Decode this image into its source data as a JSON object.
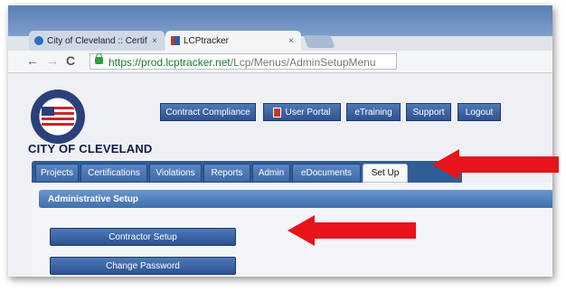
{
  "browser": {
    "tabs": [
      {
        "label": "City of Cleveland :: Certif",
        "close": "×"
      },
      {
        "label": "LCPtracker",
        "close": "×"
      }
    ],
    "nav": {
      "back": "←",
      "forward": "→",
      "reload": "C"
    },
    "url": {
      "main": "https://prod.lcptracker.net",
      "path": "/Lcp/Menus/AdminSetupMenu"
    }
  },
  "header": {
    "city_name": "CITY OF CLEVELAND",
    "seal_text": "CITY OF CLEVELAND OHIO",
    "buttons": [
      "Contract Compliance",
      "User Portal",
      "eTraining",
      "Support",
      "Logout"
    ]
  },
  "nav_tabs": {
    "items": [
      "Projects",
      "Certifications",
      "Violations",
      "Reports",
      "Admin",
      "eDocuments",
      "Set Up"
    ],
    "selected": "Set Up"
  },
  "panel": {
    "title": "Administrative Setup",
    "actions": [
      "Contractor Setup",
      "Change Password"
    ]
  },
  "annotations": {
    "arrow_color": "#e8141b",
    "arrow_count": 2
  }
}
